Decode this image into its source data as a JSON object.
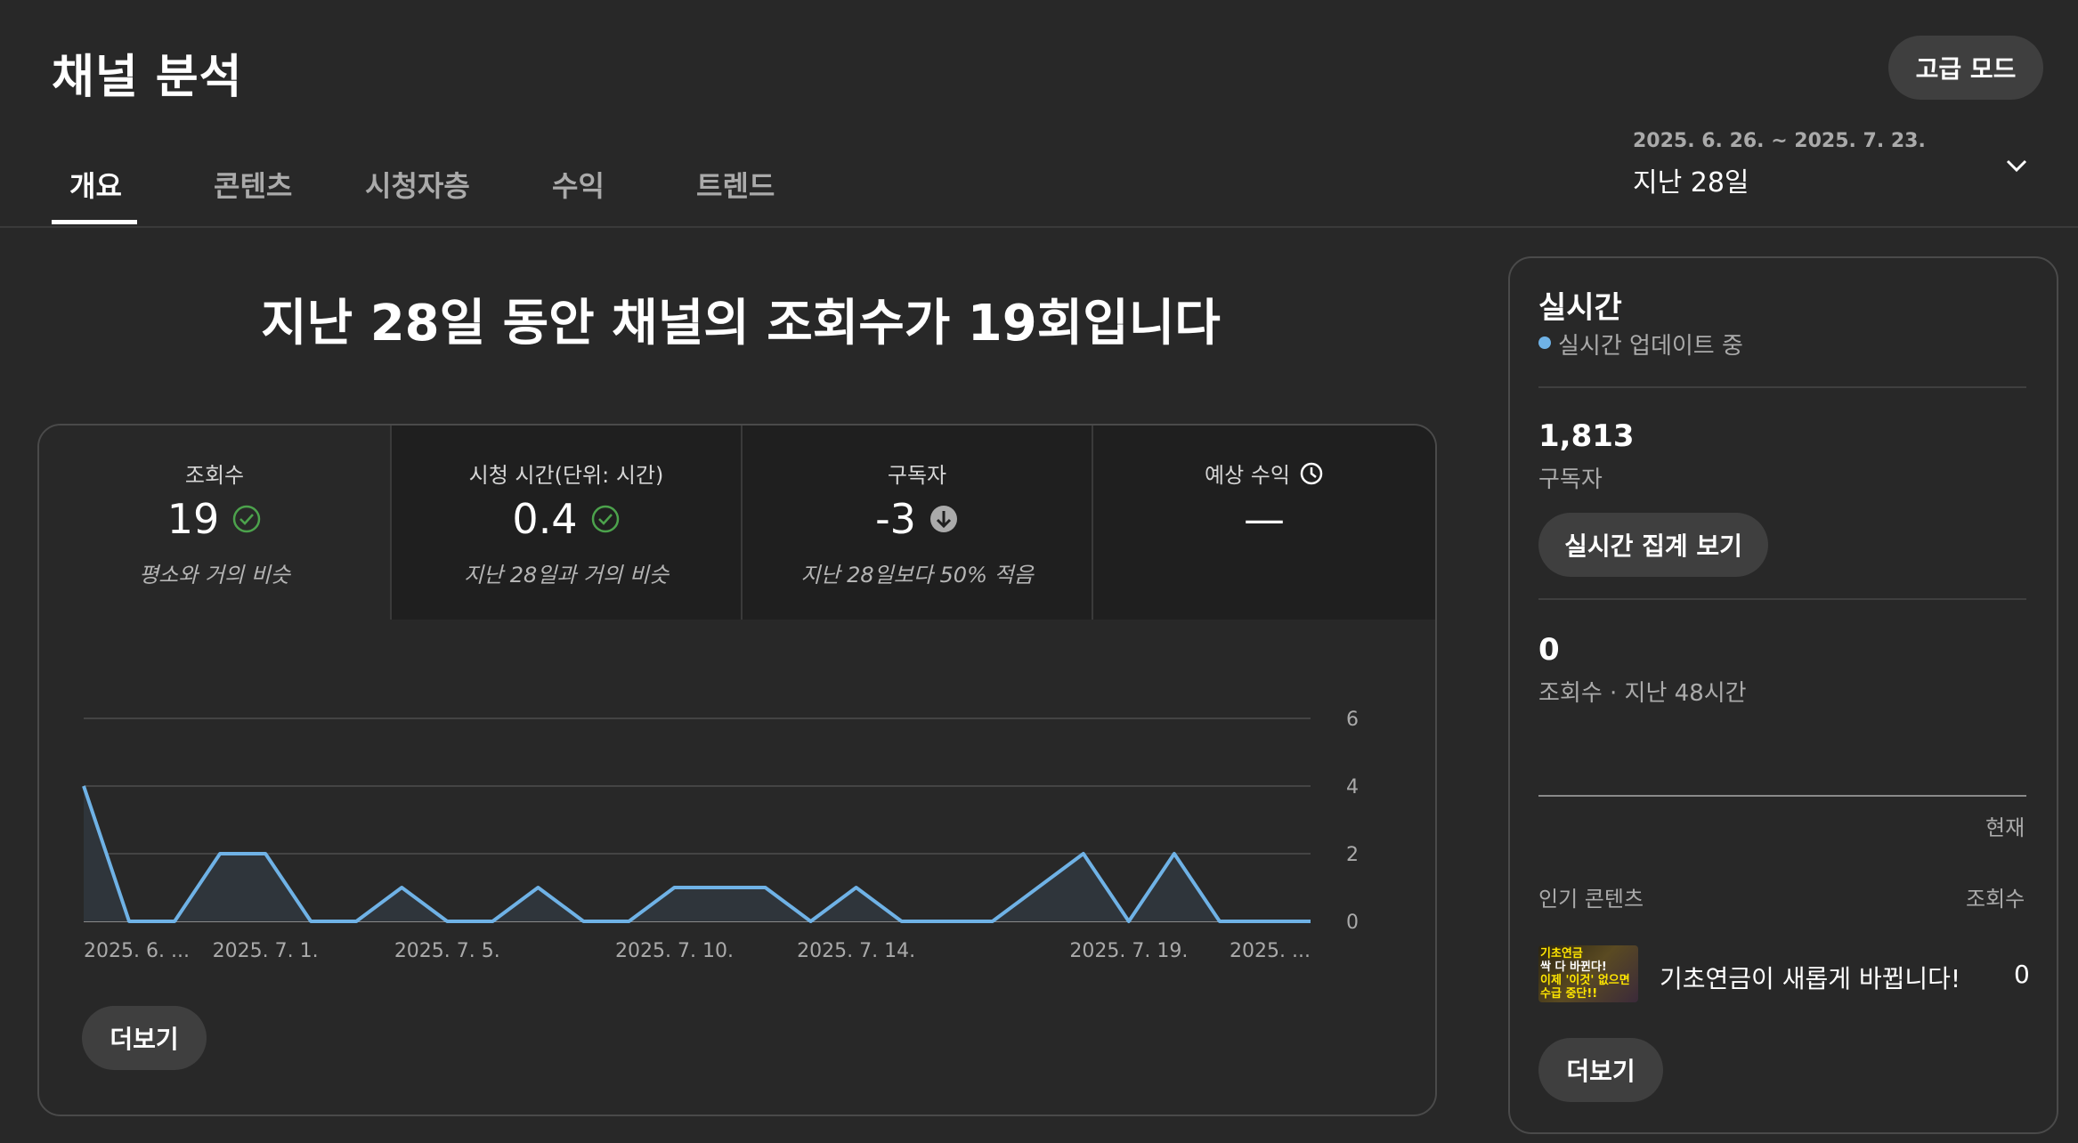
{
  "header": {
    "title": "채널 분석",
    "advanced_button": "고급 모드",
    "tabs": [
      "개요",
      "콘텐츠",
      "시청자층",
      "수익",
      "트렌드"
    ],
    "date_range": "2025. 6. 26. ~ 2025. 7. 23.",
    "date_label": "지난 28일"
  },
  "main": {
    "headline": "지난 28일 동안 채널의 조회수가 19회입니다",
    "metrics": [
      {
        "label": "조회수",
        "value": "19",
        "status_icon": "check-circle-icon",
        "sub": "평소와 거의 비슷"
      },
      {
        "label": "시청 시간(단위: 시간)",
        "value": "0.4",
        "status_icon": "check-circle-icon",
        "sub": "지난 28일과 거의 비슷"
      },
      {
        "label": "구독자",
        "value": "-3",
        "status_icon": "arrow-down-circle-icon",
        "sub": "지난 28일보다 50% 적음"
      },
      {
        "label": "예상 수익",
        "value": "—",
        "status_icon": "clock-icon",
        "sub": ""
      }
    ],
    "more_button": "더보기"
  },
  "chart_data": {
    "type": "area",
    "series": [
      {
        "values": [
          4,
          0,
          0,
          2,
          2,
          0,
          0,
          1,
          0,
          0,
          1,
          0,
          0,
          1,
          1,
          1,
          0,
          1,
          0,
          0,
          0,
          1,
          2,
          0,
          2,
          0,
          0,
          0
        ]
      }
    ],
    "x_tick_labels": [
      "2025. 6. ...",
      "2025. 7. 1.",
      "2025. 7. 5.",
      "2025. 7. 10.",
      "2025. 7. 14.",
      "2025. 7. 19.",
      "2025. ..."
    ],
    "y_ticks": [
      "0",
      "2",
      "4",
      "6"
    ],
    "ylim": [
      0,
      6
    ],
    "line_color": "#6fb2e6",
    "fill_color": "#2f353b",
    "grid": true
  },
  "realtime": {
    "title": "실시간",
    "live_text": "실시간 업데이트 중",
    "subscribers": "1,813",
    "subscribers_label": "구독자",
    "button": "실시간 집계 보기",
    "views": "0",
    "views_label": "조회수 · 지난 48시간",
    "now_label": "현재",
    "top_content_label": "인기 콘텐츠",
    "top_views_label": "조회수",
    "top_content": {
      "thumbnail_text": [
        "기초연금",
        "싹 다 바뀐다!",
        "이제 '이것' 없으면",
        "수급 중단!!"
      ],
      "title": "기초연금이 새롭게 바뀝니다! ...",
      "views": "0"
    },
    "more_button": "더보기"
  }
}
